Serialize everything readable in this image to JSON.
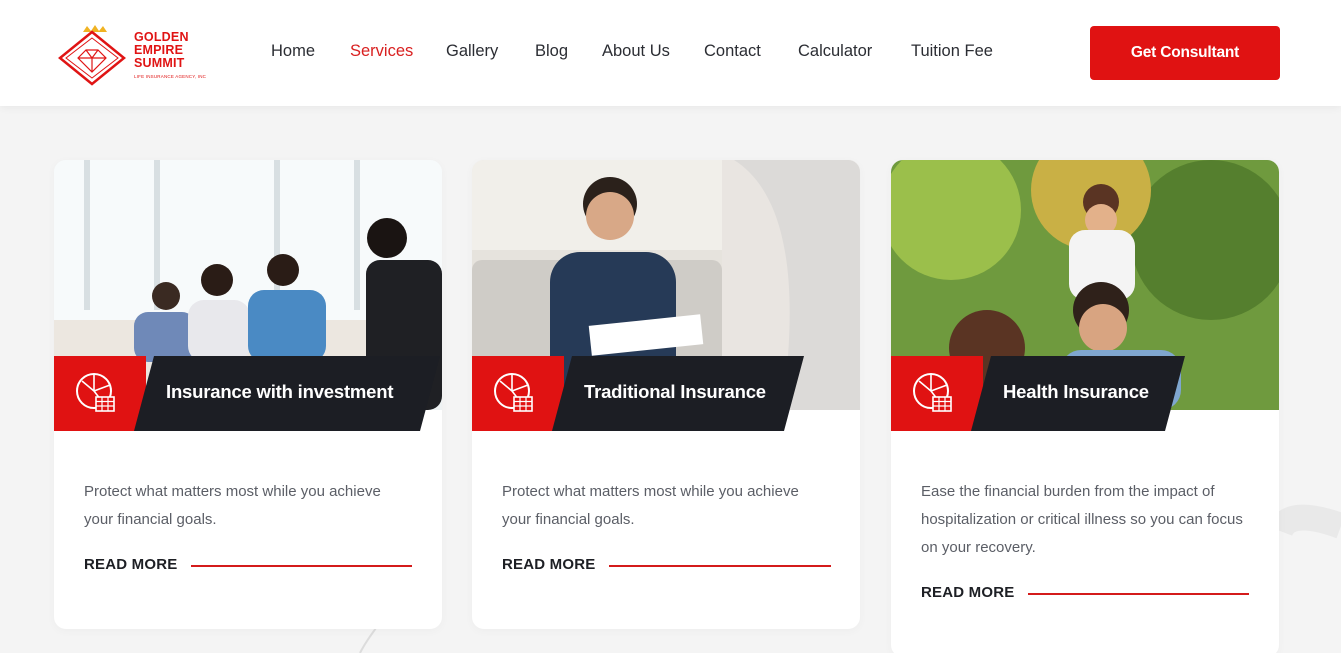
{
  "brand": {
    "name_lines": [
      "GOLDEN",
      "EMPIRE",
      "SUMMIT"
    ],
    "tagline": "LIFE INSURANCE AGENCY, INC",
    "accent": "#e01212",
    "dark": "#1c1e24"
  },
  "nav": {
    "items": [
      {
        "label": "Home",
        "active": false
      },
      {
        "label": "Services",
        "active": true
      },
      {
        "label": "Gallery",
        "active": false
      },
      {
        "label": "Blog",
        "active": false
      },
      {
        "label": "About Us",
        "active": false
      },
      {
        "label": "Contact",
        "active": false
      },
      {
        "label": "Calculator",
        "active": false
      },
      {
        "label": "Tuition Fee",
        "active": false
      }
    ],
    "cta_label": "Get Consultant"
  },
  "services": [
    {
      "title": "Insurance with investment",
      "description": "Protect what matters most while you achieve your financial goals.",
      "read_more": "READ MORE",
      "icon": "pie-chart-coins-icon",
      "photo": "family-meeting-agent-photo"
    },
    {
      "title": "Traditional Insurance",
      "description": "Protect what matters most while you achieve your financial goals.",
      "read_more": "READ MORE",
      "icon": "pie-chart-coins-icon",
      "photo": "man-signing-document-photo"
    },
    {
      "title": "Health Insurance",
      "description": "Ease the financial burden from the impact of hospitalization or critical illness so you can focus on your recovery.",
      "read_more": "READ MORE",
      "icon": "pie-chart-coins-icon",
      "photo": "happy-family-outdoors-photo"
    }
  ]
}
